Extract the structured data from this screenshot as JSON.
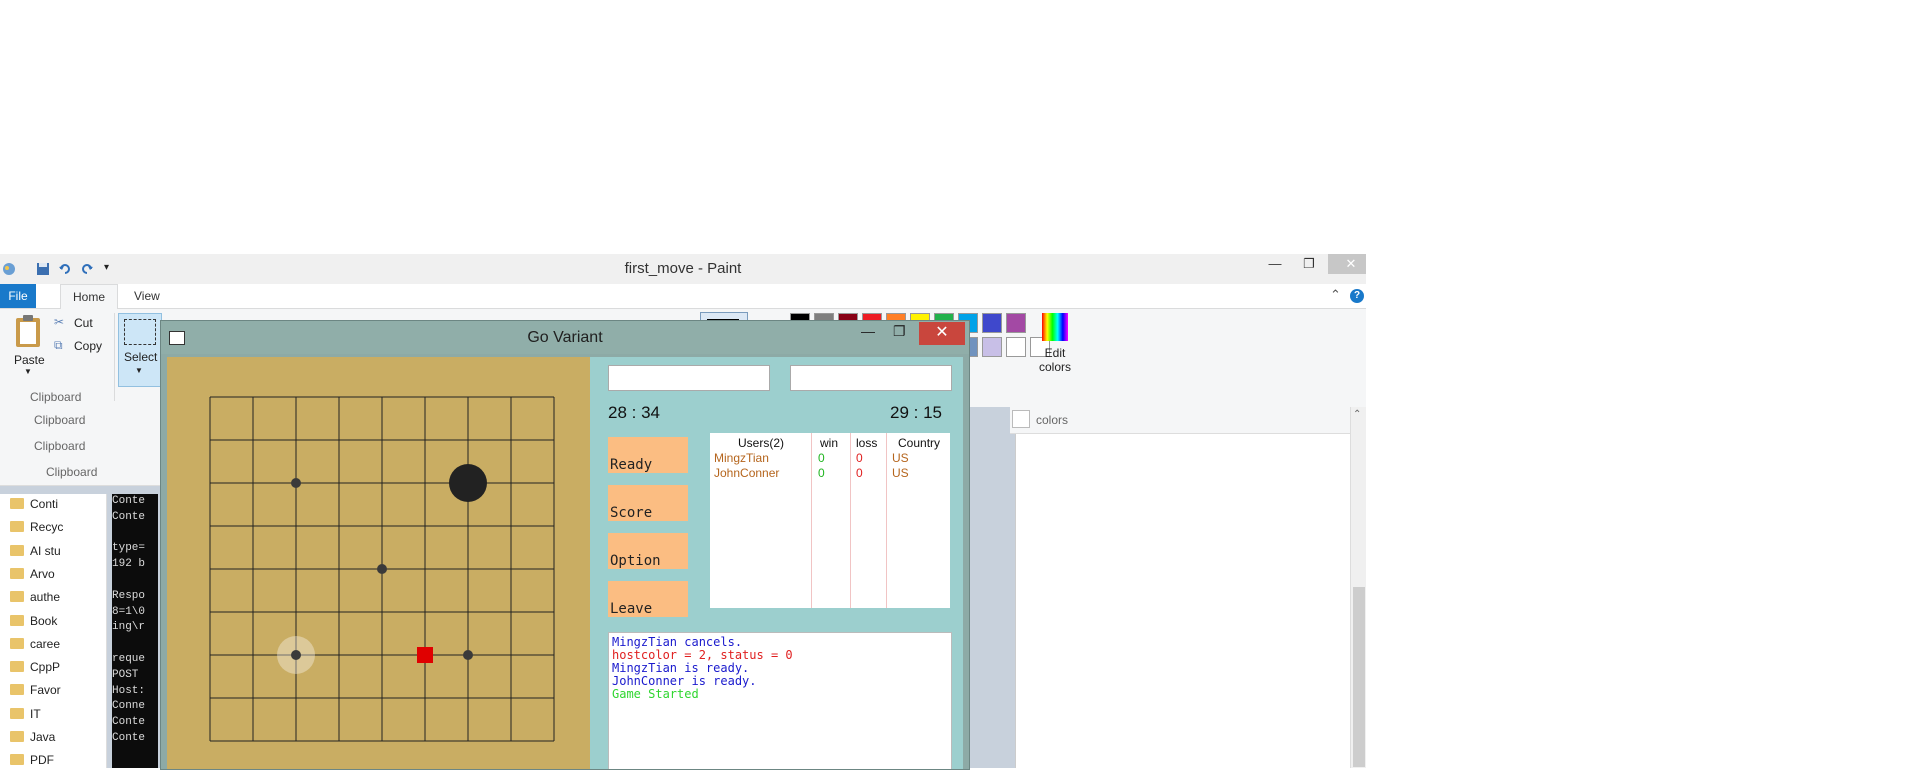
{
  "paint": {
    "title": "first_move - Paint",
    "tabs": {
      "file": "File",
      "home": "Home",
      "view": "View"
    },
    "clipboard": {
      "paste": "Paste",
      "cut": "Cut",
      "copy": "Copy",
      "group": "Clipboard"
    },
    "image": {
      "select": "Select"
    },
    "colors": {
      "edit": "Edit colors",
      "label": "colors"
    },
    "palette": [
      "#000000",
      "#7f7f7f",
      "#880015",
      "#ed1c24",
      "#ff7f27",
      "#fff200",
      "#22b14c",
      "#00a2e8",
      "#3f48cc",
      "#a349a4"
    ],
    "palette2": [
      "#7092be",
      "#c8bfe7",
      "#ffffff",
      "#ffffff"
    ]
  },
  "background_labels": {
    "clipboard": "Clipboard"
  },
  "explorer": {
    "items": [
      "Conti",
      "Recyc",
      "AI stu",
      "Arvo",
      "authe",
      "Book",
      "caree",
      "CppP",
      "Favor",
      "IT",
      "Java",
      "PDF"
    ]
  },
  "console": {
    "lines": [
      "Conte",
      "Conte",
      "",
      "type=",
      "192 b",
      "",
      "Respo",
      "8=1\\0",
      "ing\\r",
      "",
      "reque",
      "POST",
      "Host:",
      "Conne",
      "Conte",
      "Conte"
    ]
  },
  "go": {
    "title": "Go Variant",
    "player1": {
      "name": "",
      "timer": "28 : 34"
    },
    "player2": {
      "name": "",
      "timer": "29 : 15"
    },
    "buttons": {
      "ready": "Ready",
      "score": "Score",
      "option": "Option",
      "leave": "Leave"
    },
    "users": {
      "headers": {
        "users": "Users(2)",
        "win": "win",
        "loss": "loss",
        "country": "Country"
      },
      "rows": [
        {
          "name": "MingzTian",
          "win": "0",
          "loss": "0",
          "country": "US"
        },
        {
          "name": "JohnConner",
          "win": "0",
          "loss": "0",
          "country": "US"
        }
      ]
    },
    "log": [
      {
        "text": "MingzTian cancels.",
        "color": "#1a1acd"
      },
      {
        "text": "hostcolor = 2, status = 0",
        "color": "#e02020"
      },
      {
        "text": "MingzTian is ready.",
        "color": "#1a1acd"
      },
      {
        "text": "JohnConner is ready.",
        "color": "#1a1acd"
      },
      {
        "text": "Game Started",
        "color": "#2fd62f"
      }
    ],
    "board": {
      "size": 9,
      "stones": [
        {
          "col": 6,
          "row": 2,
          "color": "black"
        }
      ],
      "star_points": [
        {
          "col": 2,
          "row": 2
        },
        {
          "col": 4,
          "row": 4
        },
        {
          "col": 6,
          "row": 6
        },
        {
          "col": 2,
          "row": 6
        }
      ],
      "ghost": {
        "col": 2,
        "row": 6
      },
      "last_move_marker": {
        "col": 5,
        "row": 6,
        "color": "#e00000"
      }
    }
  }
}
